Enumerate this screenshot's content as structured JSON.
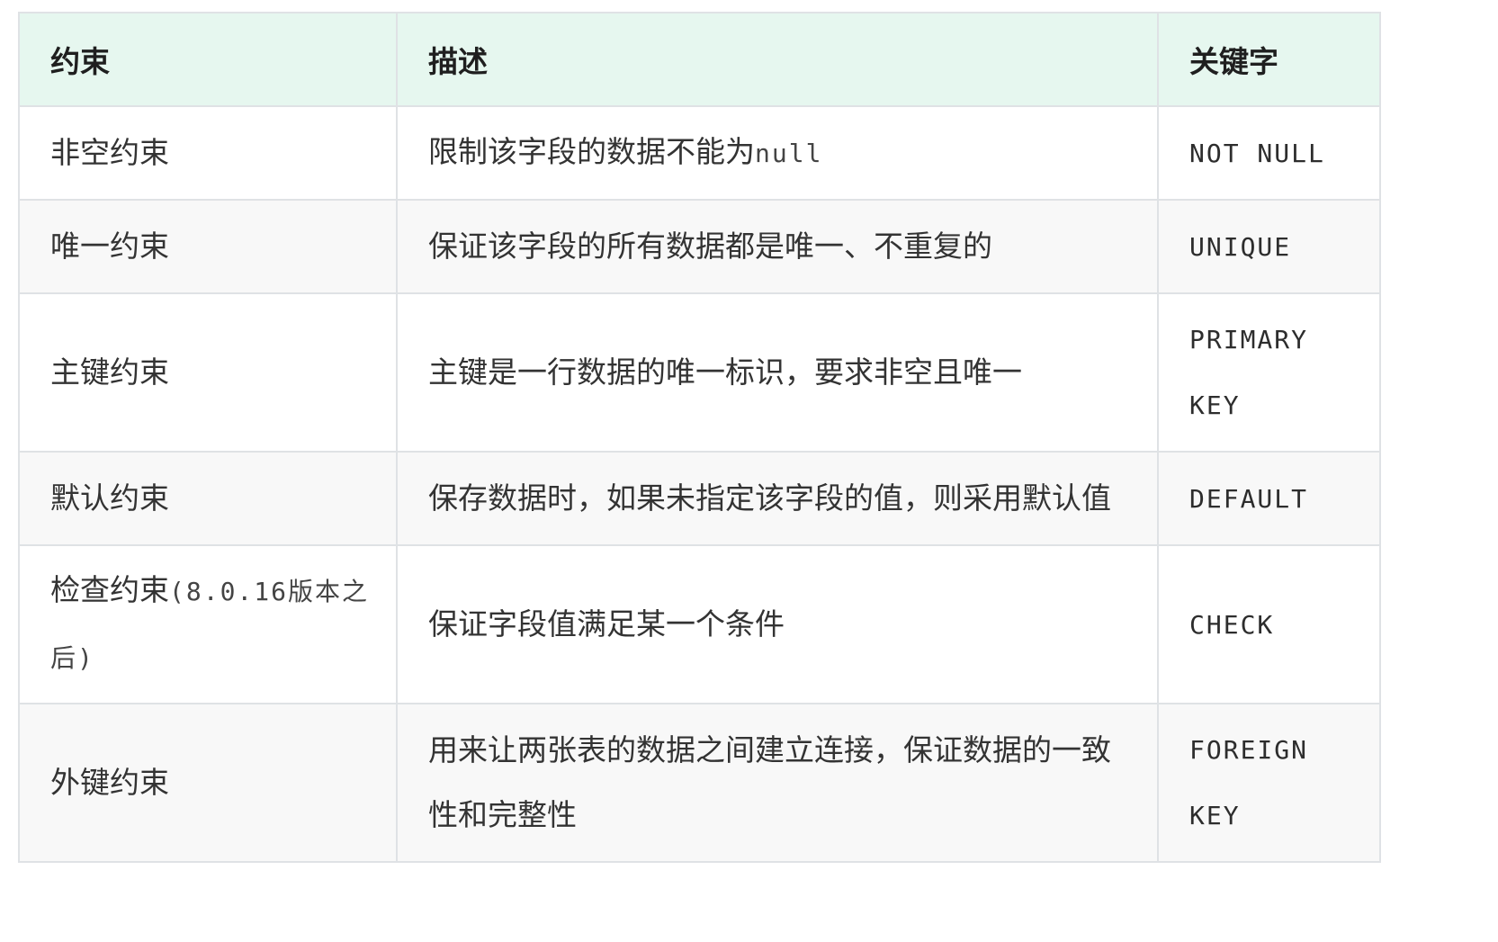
{
  "table": {
    "headers": [
      "约束",
      "描述",
      "关键字"
    ],
    "rows": [
      {
        "name": "非空约束",
        "description": "限制该字段的数据不能为",
        "description_code": "null",
        "keyword": "NOT NULL"
      },
      {
        "name": "唯一约束",
        "description": "保证该字段的所有数据都是唯一、不重复的",
        "keyword": "UNIQUE"
      },
      {
        "name": "主键约束",
        "description": "主键是一行数据的唯一标识，要求非空且唯一",
        "keyword": "PRIMARY KEY"
      },
      {
        "name": "默认约束",
        "description": "保存数据时，如果未指定该字段的值，则采用默认值",
        "keyword": "DEFAULT"
      },
      {
        "name": "检查约束",
        "name_suffix": "(8.0.16版本之后)",
        "description": "保证字段值满足某一个条件",
        "keyword": "CHECK"
      },
      {
        "name": "外键约束",
        "description": "用来让两张表的数据之间建立连接，保证数据的一致性和完整性",
        "keyword": "FOREIGN KEY"
      }
    ]
  },
  "colors": {
    "header_bg": "#e6f7ef",
    "border": "#dfe2e5",
    "alt_row_bg": "#f8f8f8"
  }
}
